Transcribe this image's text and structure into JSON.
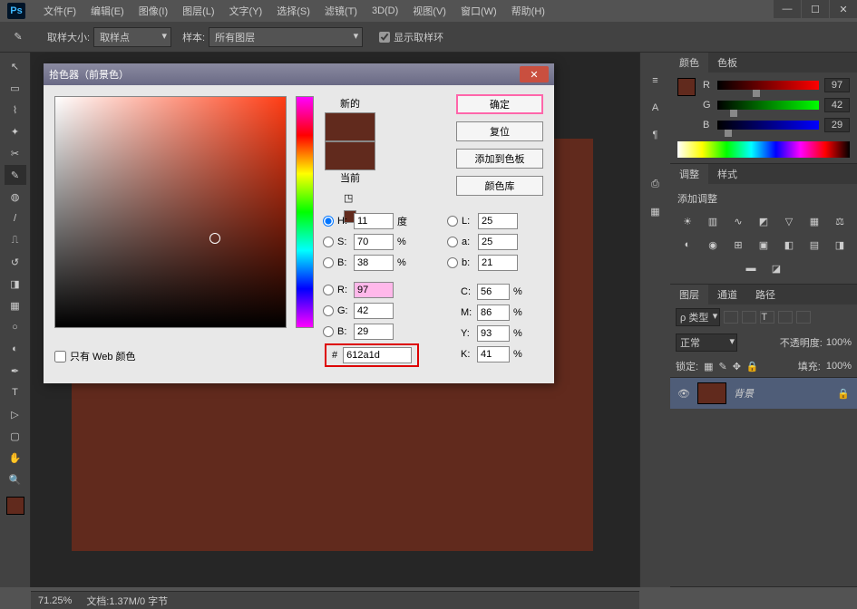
{
  "app": {
    "logo": "Ps"
  },
  "menu": [
    "文件(F)",
    "编辑(E)",
    "图像(I)",
    "图层(L)",
    "文字(Y)",
    "选择(S)",
    "滤镜(T)",
    "3D(D)",
    "视图(V)",
    "窗口(W)",
    "帮助(H)"
  ],
  "options": {
    "sample_size_label": "取样大小:",
    "sample_size": "取样点",
    "sample_label": "样本:",
    "sample": "所有图层",
    "show_ring": "显示取样环"
  },
  "dialog": {
    "title": "拾色器（前景色）",
    "new_label": "新的",
    "current_label": "当前",
    "buttons": {
      "ok": "确定",
      "reset": "复位",
      "add": "添加到色板",
      "lib": "颜色库"
    },
    "hsb": {
      "h_label": "H:",
      "h": "11",
      "h_unit": "度",
      "s_label": "S:",
      "s": "70",
      "s_unit": "%",
      "b_label": "B:",
      "b": "38",
      "b_unit": "%"
    },
    "rgb": {
      "r_label": "R:",
      "r": "97",
      "g_label": "G:",
      "g": "42",
      "b_label": "B:",
      "b": "29"
    },
    "lab": {
      "l_label": "L:",
      "l": "25",
      "a_label": "a:",
      "a": "25",
      "b_label": "b:",
      "b": "21"
    },
    "cmyk": {
      "c_label": "C:",
      "c": "56",
      "m_label": "M:",
      "m": "86",
      "y_label": "Y:",
      "y": "93",
      "k_label": "K:",
      "k": "41",
      "unit": "%"
    },
    "hex_label": "#",
    "hex": "612a1d",
    "webonly": "只有 Web 颜色"
  },
  "panels": {
    "color_tab": "颜色",
    "swatch_tab": "色板",
    "rgb": {
      "r": "R",
      "g": "G",
      "b": "B",
      "rv": "97",
      "gv": "42",
      "bv": "29"
    },
    "adjust_tab": "调整",
    "styles_tab": "样式",
    "adjust_title": "添加调整",
    "layers_tab": "图层",
    "channels_tab": "通道",
    "paths_tab": "路径",
    "filter_kind": "ρ 类型",
    "blend": "正常",
    "opacity_label": "不透明度:",
    "opacity": "100%",
    "lock_label": "锁定:",
    "fill_label": "填充:",
    "fill": "100%",
    "bg_layer": "背景"
  },
  "status": {
    "zoom": "71.25%",
    "doc": "文档:1.37M/0 字节"
  }
}
